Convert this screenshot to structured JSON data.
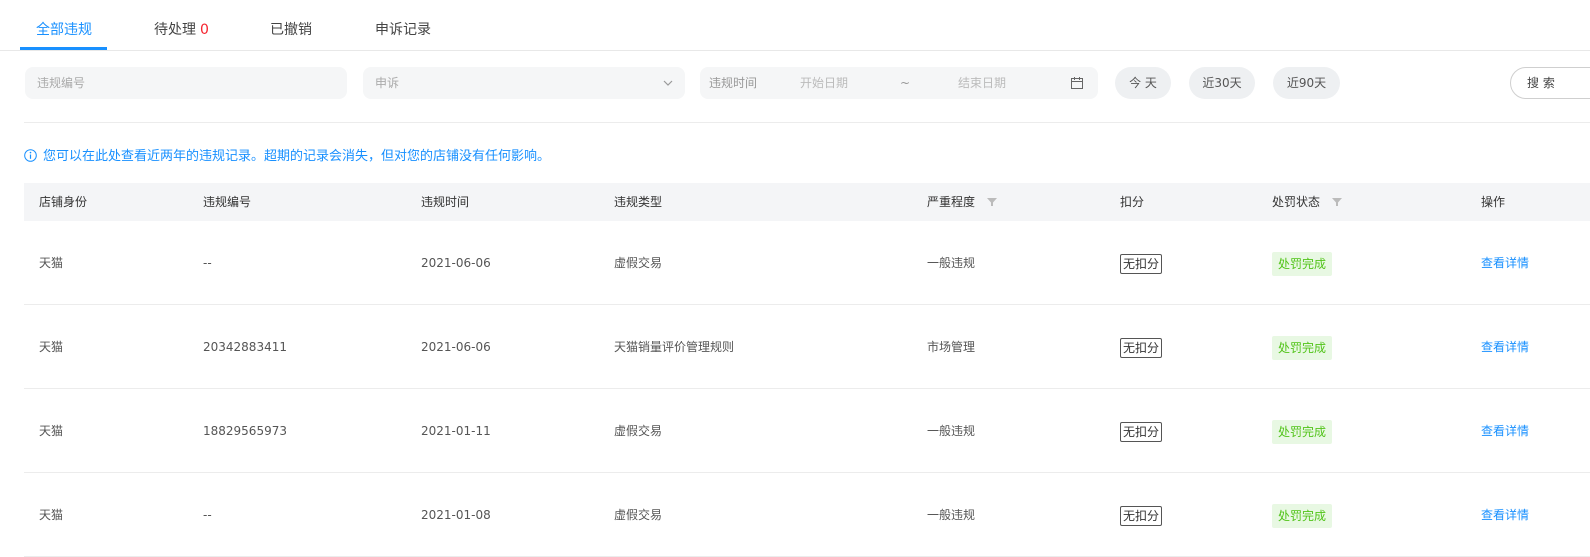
{
  "tabs": [
    {
      "label": "全部违规",
      "active": true
    },
    {
      "label": "待处理",
      "badge": "0"
    },
    {
      "label": "已撤销"
    },
    {
      "label": "申诉记录"
    }
  ],
  "filters": {
    "id_placeholder": "违规编号",
    "type_select_value": "申诉",
    "time_label": "违规时间",
    "start_placeholder": "开始日期",
    "range_separator": "~",
    "end_placeholder": "结束日期",
    "quick_today": "今 天",
    "quick_30": "近30天",
    "quick_90": "近90天",
    "search_label": "搜 索"
  },
  "notice": "您可以在此处查看近两年的违规记录。超期的记录会消失，但对您的店铺没有任何影响。",
  "table": {
    "columns": [
      "店铺身份",
      "违规编号",
      "违规时间",
      "违规类型",
      "严重程度",
      "扣分",
      "处罚状态",
      "操作"
    ],
    "rows": [
      {
        "identity": "天猫",
        "id": "--",
        "time": "2021-06-06",
        "type": "虚假交易",
        "severity": "一般违规",
        "deduct": "无扣分",
        "status": "处罚完成",
        "action": "查看详情"
      },
      {
        "identity": "天猫",
        "id": "20342883411",
        "time": "2021-06-06",
        "type": "天猫销量评价管理规则",
        "severity": "市场管理",
        "deduct": "无扣分",
        "status": "处罚完成",
        "action": "查看详情"
      },
      {
        "identity": "天猫",
        "id": "18829565973",
        "time": "2021-01-11",
        "type": "虚假交易",
        "severity": "一般违规",
        "deduct": "无扣分",
        "status": "处罚完成",
        "action": "查看详情"
      },
      {
        "identity": "天猫",
        "id": "--",
        "time": "2021-01-08",
        "type": "虚假交易",
        "severity": "一般违规",
        "deduct": "无扣分",
        "status": "处罚完成",
        "action": "查看详情"
      }
    ]
  },
  "colors": {
    "accent": "#1890ff",
    "badge": "#f5222d",
    "status_bg": "#e8f8e3",
    "status_text": "#52c41a"
  }
}
